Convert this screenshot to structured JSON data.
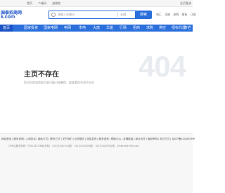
{
  "topbar": {
    "left_items": [
      "首页",
      "二维码",
      "加微信"
    ],
    "right_items": [
      "全页登录"
    ]
  },
  "logo": {
    "line1": "国泰招商网",
    "line2": "k.com"
  },
  "search": {
    "placeholder": "请输入关键词",
    "category": "公司",
    "button": "搜索"
  },
  "quick_links": [
    "电汇",
    "注册",
    "采购",
    "招标",
    "订阅"
  ],
  "nav": {
    "items": [
      "首页",
      "国家投资",
      "国家电网",
      "电网",
      "市电",
      "大唐",
      "华能",
      "行情",
      "招商",
      "求购",
      "供应",
      "招标代理",
      "专栏"
    ]
  },
  "not_found": {
    "title": "主页不存在",
    "description": "您访问的该商家页面可能已经删除，要查看的东西不存在",
    "code": "404"
  },
  "footer": {
    "links": [
      "网站首页",
      "服务说明",
      "入网协议",
      "隐私方式",
      "联系方式",
      "关于我们",
      "合作模式",
      "信息发布",
      "服务咨询",
      "帮助中心",
      "友情链接",
      "商业合作",
      "版权声明",
      "支付方式",
      "京ICP备12345678号"
    ],
    "info": "CRM云服务热线：0755-32471866(总机)　0147(10)10741(线)　010-32471000(线)　0147(14)07400(线)　Email:ke@7400.com"
  }
}
